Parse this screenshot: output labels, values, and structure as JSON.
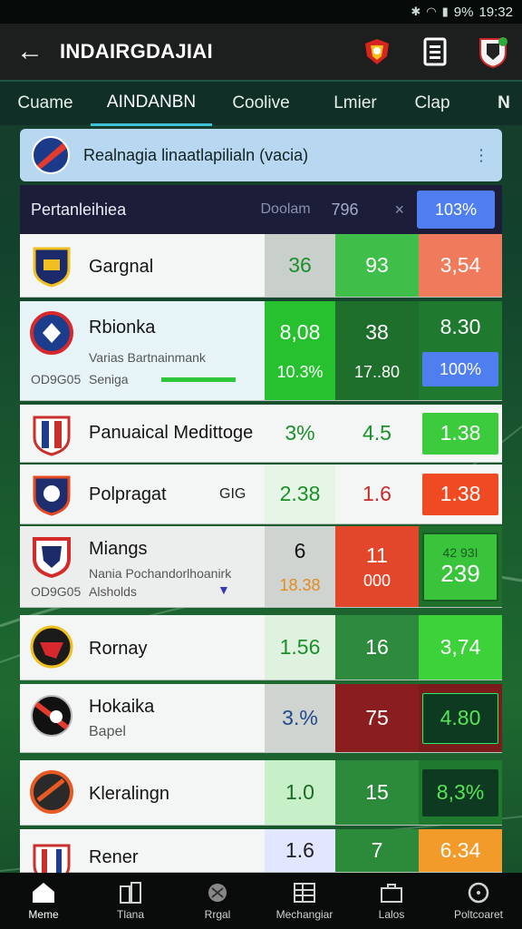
{
  "status": {
    "battery": "9%",
    "time": "19:32"
  },
  "app_bar": {
    "title": "INDAIRGDAJIAI"
  },
  "tabs": [
    "Cuame",
    "AINDANBN",
    "Coolive",
    "Lmier",
    "Clap"
  ],
  "tab_more": "N",
  "banner": {
    "text": "Realnagia linaatlapilialn (vacia)"
  },
  "header": {
    "label": "Pertanleihiea",
    "col2": "Doolam",
    "col3": "796",
    "close": "×",
    "pct": "103%"
  },
  "rows": [
    {
      "name": "Gargnal",
      "v1": "36",
      "v2": "93",
      "v3": "3,54"
    },
    {
      "name": "Rbionka",
      "meta": "Varias Bartnainmank",
      "meta2": "Seniga",
      "code": "OD9G05",
      "v1": "8,08",
      "v1b": "10.3%",
      "v2": "38",
      "v2b": "17..80",
      "v3": "8.30",
      "v3b": "100%"
    },
    {
      "name": "Panuaical Medittoge",
      "v1": "3%",
      "v2": "4.5",
      "v3": "1.38"
    },
    {
      "name": "Polpragat",
      "tag": "GIG",
      "v1": "2.38",
      "v2": "1.6",
      "v3": "1.38"
    },
    {
      "name": "Miangs",
      "meta": "Nania Pochandorlhoanirk",
      "meta2": "Alsholds",
      "code": "OD9G05",
      "v1": "6",
      "v1b": "18.38",
      "v2": "11",
      "v2b": "000",
      "v3": "239",
      "v3b": "42 93I"
    },
    {
      "name": "Rornay",
      "v1": "1.56",
      "v2": "16",
      "v3": "3,74"
    },
    {
      "name": "Hokaika",
      "meta": "Bapel",
      "v1": "3.%",
      "v2": "75",
      "v3": "4.80"
    },
    {
      "name": "Kleralingn",
      "v1": "1.0",
      "v2": "15",
      "v3": "8,3%"
    },
    {
      "name": "Rener",
      "v1": "1.6",
      "v2": "7",
      "v3": "6.34"
    }
  ],
  "nav": [
    "Meme",
    "Tlana",
    "Rrgal",
    "Mechangiar",
    "Lalos",
    "Poltcoaret"
  ],
  "colors": {
    "accent": "#3fc2d5",
    "green": "#2fbf3a",
    "red": "#e0442a",
    "blue": "#4f7ef0"
  }
}
